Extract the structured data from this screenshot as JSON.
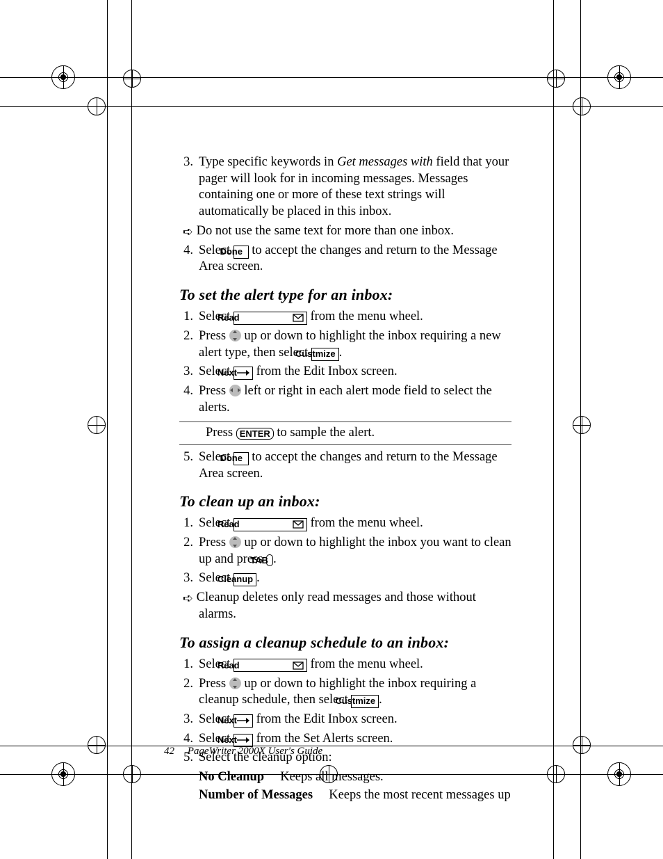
{
  "btns": {
    "done": "Done",
    "read": "Read",
    "customize": "Custmize",
    "next": "Next",
    "enter": "ENTER",
    "tab": "TAB",
    "cleanup": "Cleanup"
  },
  "step3_text_a": "Type specific keywords in ",
  "step3_field": "Get messages with",
  "step3_text_b": " field that your pager will look for in incoming messages. Messages containing one or more of these text strings will automatically be placed in this inbox.",
  "note1": "Do not use the same text for more than one inbox.",
  "step4a_prefix": "Select ",
  "step4a_suffix": " to accept the changes and return to the Message Area screen.",
  "heading1": "To set the alert type for an inbox:",
  "h1_s1_prefix": "Select ",
  "h1_s1_suffix": " from the menu wheel.",
  "h1_s2_prefix": "Press ",
  "h1_s2_mid": " up or down to highlight the inbox requiring a new alert type, then select ",
  "h1_s2_suffix": ".",
  "h1_s3_prefix": "Select ",
  "h1_s3_suffix": " from the Edit Inbox screen.",
  "h1_s4_prefix": "Press ",
  "h1_s4_suffix": " left or right in each alert mode field to select the alerts.",
  "tip_prefix": "Press ",
  "tip_suffix": " to sample the alert.",
  "h1_s5_prefix": "Select ",
  "h1_s5_suffix": " to accept the changes and return to the Message Area screen.",
  "heading2": "To clean up an inbox:",
  "h2_s1_prefix": "Select ",
  "h2_s1_suffix": " from the menu wheel.",
  "h2_s2_prefix": "Press ",
  "h2_s2_mid": " up or down to highlight the inbox you want to clean up and press ",
  "h2_s2_suffix": ".",
  "h2_s3_prefix": "Select ",
  "h2_s3_suffix": ".",
  "note2": "Cleanup deletes only read messages and those without alarms.",
  "heading3": "To assign a cleanup schedule to an inbox:",
  "h3_s1_prefix": "Select ",
  "h3_s1_suffix": " from the menu wheel.",
  "h3_s2_prefix": "Press ",
  "h3_s2_mid": " up or down to highlight the inbox requiring a cleanup schedule, then select ",
  "h3_s2_suffix": ".",
  "h3_s3_prefix": "Select ",
  "h3_s3_suffix": " from the Edit Inbox screen.",
  "h3_s4_prefix": "Select ",
  "h3_s4_suffix": " from the Set Alerts screen.",
  "h3_s5": "Select the cleanup option:",
  "opt1_label": "No Cleanup",
  "opt1_desc": "Keeps all messages.",
  "opt2_label": "Number of Messages",
  "opt2_desc": "Keeps the most recent messages up",
  "footer_page": "42",
  "footer_title": "PageWriter 2000X User's Guide"
}
